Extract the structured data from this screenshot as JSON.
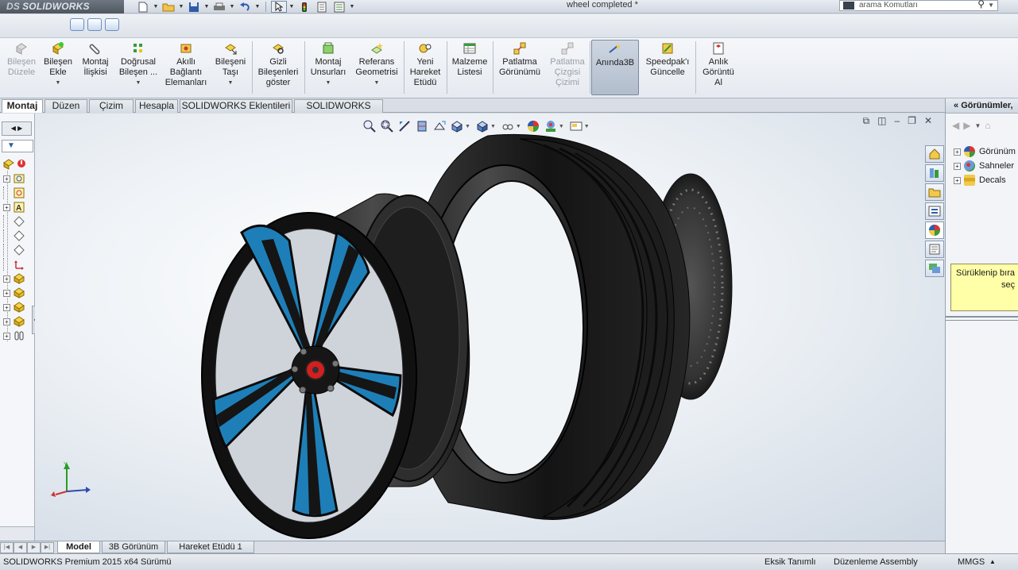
{
  "app": {
    "logo_prefix": "DS",
    "logo_text": "SOLIDWORKS",
    "document_title": "wheel completed *",
    "search_placeholder": "arama Komutları"
  },
  "command_manager": [
    {
      "id": "edit-component",
      "label": "Bileşen\nDüzele",
      "disabled": true,
      "dropdown": false
    },
    {
      "id": "insert-components",
      "label": "Bileşen\nEkle",
      "disabled": false,
      "dropdown": true
    },
    {
      "id": "mate",
      "label": "Montaj\nİlişkisi",
      "disabled": false,
      "dropdown": false
    },
    {
      "id": "linear-pattern",
      "label": "Doğrusal\nBileşen ...",
      "disabled": false,
      "dropdown": true
    },
    {
      "id": "smart-fasteners",
      "label": "Akıllı\nBağlantı\nElemanları",
      "disabled": false,
      "dropdown": false
    },
    {
      "id": "move-component",
      "label": "Bileşeni\nTaşı",
      "disabled": false,
      "dropdown": true
    },
    {
      "id": "show-hidden",
      "label": "Gizli\nBileşenleri\ngöster",
      "disabled": false,
      "dropdown": false
    },
    {
      "id": "assembly-features",
      "label": "Montaj\nUnsurları",
      "disabled": false,
      "dropdown": true
    },
    {
      "id": "reference-geometry",
      "label": "Referans\nGeometrisi",
      "disabled": false,
      "dropdown": true
    },
    {
      "id": "new-motion-study",
      "label": "Yeni\nHareket\nEtüdü",
      "disabled": false,
      "dropdown": false
    },
    {
      "id": "bill-of-materials",
      "label": "Malzeme\nListesi",
      "disabled": false,
      "dropdown": false
    },
    {
      "id": "exploded-view",
      "label": "Patlatma\nGörünümü",
      "disabled": false,
      "dropdown": false
    },
    {
      "id": "explode-line-sketch",
      "label": "Patlatma\nÇizgisi\nÇizimi",
      "disabled": true,
      "dropdown": false
    },
    {
      "id": "instant3d",
      "label": "Anında3B",
      "disabled": false,
      "dropdown": false,
      "active": true
    },
    {
      "id": "speedpak",
      "label": "Speedpak'ı\nGüncelle",
      "disabled": false,
      "dropdown": false
    },
    {
      "id": "snapshot",
      "label": "Anlık\nGörüntü\nAl",
      "disabled": false,
      "dropdown": false
    }
  ],
  "tabs": [
    "Montaj",
    "Düzen",
    "Çizim",
    "Hesapla",
    "SOLIDWORKS Eklentileri",
    "SOLIDWORKS MBD"
  ],
  "bottom_tabs": [
    "Model",
    "3B Görünüm",
    "Hareket Etüdü 1"
  ],
  "status": {
    "product": "SOLIDWORKS Premium 2015 x64 Sürümü",
    "definition": "Eksik Tanımlı",
    "mode": "Düzenleme Assembly",
    "units": "MMGS"
  },
  "task_pane": {
    "title": "Görünümler,",
    "items": [
      "Görünüm",
      "Sahneler",
      "Decals"
    ],
    "hint_line1": "Sürüklenip bıra",
    "hint_line2": "seç"
  },
  "colors": {
    "rim_accent": "#1e7fb8",
    "tire": "#1a1a1a",
    "hub_cap": "#d31f1f"
  }
}
